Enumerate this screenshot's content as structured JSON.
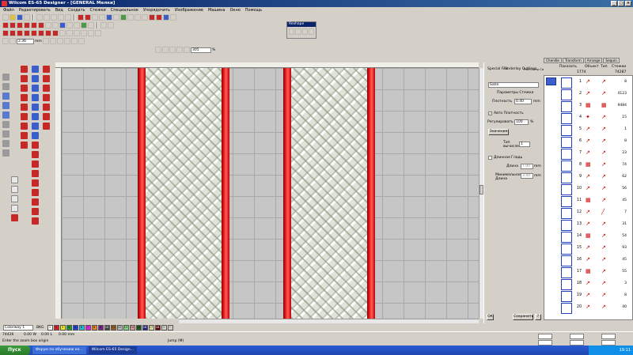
{
  "window": {
    "title": "Wilcom ES-65 Designer - [GENERAL      Мелки]"
  },
  "menu": [
    "Файл",
    "Редактировать",
    "Вид",
    "Создать",
    "Стежки",
    "Специальное",
    "Упорядочить",
    "Изображение",
    "Машина",
    "Окно",
    "Помощь"
  ],
  "toolbar": {
    "zoom_value": "2.36",
    "unit": "mm",
    "percent_value": "305",
    "percent_unit": "%"
  },
  "reshape_panel": {
    "title": "Reshape"
  },
  "properties": {
    "tabs": [
      "Special Fills",
      "Underlay Outlines",
      "Pull Comp Connectors"
    ],
    "stitch_type": "Satin",
    "params_header": "Параметры Стежка",
    "density_label": "Плотность",
    "density_value": "0.40",
    "density_unit": "mm",
    "auto_density_label": "Авто Плотность",
    "adjust_label": "Регулировать",
    "adjust_value": "100",
    "adjust_unit": "%",
    "values_button": "Значения",
    "type_label": "Тип вычисления",
    "type_value": "1",
    "long_stitch_label": "Длинная Гладь",
    "length_label": "Длина",
    "length_value": "7.00",
    "length_unit": "mm",
    "min_length_label": "Минимальная Длина",
    "min_length_value": "3.40",
    "min_length_unit": "mm",
    "ok_button": "ОК",
    "save_button": "Сохранить",
    "help_button": "?"
  },
  "sequence": {
    "tabs": [
      "Chenille",
      "Transform",
      "Arrange",
      "Sequin"
    ],
    "show_button": "Показать",
    "columns": [
      "Объект",
      "Тип",
      "Стежки"
    ],
    "total_left": "1774",
    "total_right": "74287",
    "rows": [
      {
        "num": "1",
        "count": "8"
      },
      {
        "num": "2",
        "count": "4123"
      },
      {
        "num": "3",
        "count": "9484"
      },
      {
        "num": "4",
        "count": "15"
      },
      {
        "num": "5",
        "count": "1"
      },
      {
        "num": "6",
        "count": "8"
      },
      {
        "num": "7",
        "count": "23"
      },
      {
        "num": "8",
        "count": "74"
      },
      {
        "num": "9",
        "count": "62"
      },
      {
        "num": "10",
        "count": "56"
      },
      {
        "num": "11",
        "count": "45"
      },
      {
        "num": "12",
        "count": "7"
      },
      {
        "num": "13",
        "count": "31"
      },
      {
        "num": "14",
        "count": "54"
      },
      {
        "num": "15",
        "count": "93"
      },
      {
        "num": "16",
        "count": "45"
      },
      {
        "num": "17",
        "count": "55"
      },
      {
        "num": "18",
        "count": "3"
      },
      {
        "num": "19",
        "count": "8"
      },
      {
        "num": "20",
        "count": "40"
      }
    ]
  },
  "bottom": {
    "colorway": "Colorway 1",
    "bkg_label": "BKG"
  },
  "status": {
    "coord": "74426",
    "dx": "0.00 W",
    "dy": "0.00 L",
    "d3": "0.00 mm",
    "hint": "Enter the zoom box origin",
    "mode": "Jump (M)"
  },
  "taskbar": {
    "start": "Пуск",
    "tasks": [
      "Форум по обучению ко...",
      "Wilcom ES-65 Design..."
    ],
    "time": "19:11"
  }
}
